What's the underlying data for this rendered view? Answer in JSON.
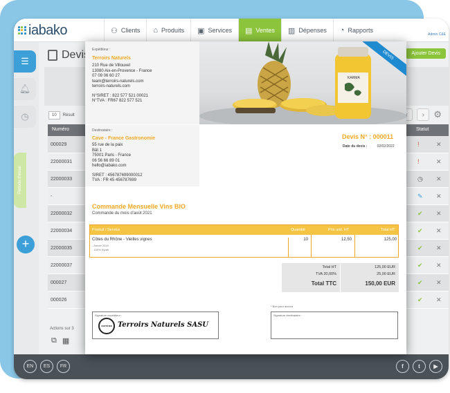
{
  "brand": "iabako",
  "nav": [
    {
      "label": "Clients",
      "icon": "person-icon"
    },
    {
      "label": "Produits",
      "icon": "tag-icon"
    },
    {
      "label": "Services",
      "icon": "briefcase-icon"
    },
    {
      "label": "Ventes",
      "icon": "receipt-icon"
    },
    {
      "label": "Dépenses",
      "icon": "ledger-icon"
    },
    {
      "label": "Rapports",
      "icon": "pie-chart-icon"
    }
  ],
  "admin_label": "Admin C&E",
  "sidebar": {
    "green_tab": "Période d'essai"
  },
  "page": {
    "title": "Devis",
    "add_button": "Ajouter Devis"
  },
  "list": {
    "per_page": "10",
    "results_label": "Résult",
    "col_number": "Numéro",
    "col_status": "Statut",
    "rows": [
      {
        "number": "000029",
        "status": "!"
      },
      {
        "number": "22000031",
        "status": "!"
      },
      {
        "number": "22000033",
        "status": "◷"
      },
      {
        "number": "-",
        "status": "✎"
      },
      {
        "number": "22000032",
        "status": "✔"
      },
      {
        "number": "22000034",
        "status": "✔"
      },
      {
        "number": "22000035",
        "status": "✔"
      },
      {
        "number": "22000037",
        "status": "✔"
      },
      {
        "number": "000027",
        "status": "✔"
      },
      {
        "number": "000026",
        "status": "✔"
      }
    ],
    "actions_label": "Actions sur 3"
  },
  "languages": [
    "EN",
    "ES",
    "FR"
  ],
  "social": [
    "f",
    "t",
    "▶"
  ],
  "colors": {
    "accent_green": "#8cc43c",
    "accent_blue": "#3d9fd8",
    "doc_orange": "#f0a823"
  },
  "doc": {
    "sender_label": "Expéditeur :",
    "sender_name": "Terroirs Naturels",
    "sender_lines": [
      "210 Rue de Villouxel",
      "13080 Aix-en-Provence - France",
      "07 09 06 60 27",
      "team@terroirs-naturels.com",
      "terroirs-naturels.com"
    ],
    "sender_ids": [
      "N°SIRET : 822 577 521 00021",
      "N°TVA : FR67 822 577 521"
    ],
    "ribbon": "DEVIS",
    "recipient_label": "Destinataire :",
    "recipient_name": "Cave - France Gastronomie",
    "recipient_lines": [
      "55 rue de la paix",
      "Bât 1",
      "75001 Paris - France",
      "06 56 66 89 01",
      "hello@iabako.com"
    ],
    "recipient_ids": [
      "SIRET : 456787699000012",
      "TVA : FR 45 456787699"
    ],
    "quote_number": "Devis N° : 000011",
    "date_label": "Date du devis :",
    "date_value": "02/02/2022",
    "order_title": "Commande Mensuelle Vins BIO",
    "order_sub": "Commande du mois d'août 2021",
    "line_headers": {
      "product": "Produit / Service",
      "qty": "Quantité",
      "unit": "Prix unit. HT",
      "total": "Total HT"
    },
    "line": {
      "product": "Côtes du Rhône - Vieilles vignes",
      "details": [
        "- Année 2019",
        "- 100% Syrah"
      ],
      "qty": "10",
      "unit": "12,50",
      "total": "125,00"
    },
    "totals": [
      {
        "label": "Total HT",
        "value": "125,00 EUR"
      },
      {
        "label": "TVA 20,00%",
        "value": "25,00 EUR"
      },
      {
        "label": "Total TTC",
        "value": "150,00 EUR"
      }
    ],
    "bon_pour_accord": "* Bon pour accord",
    "sig_sender_label": "Signature expéditeur :",
    "sig_recipient_label": "Signature destinataire :",
    "stamp_text": "CERTIFIED",
    "signature_name": "Terroirs Naturels SASU"
  }
}
